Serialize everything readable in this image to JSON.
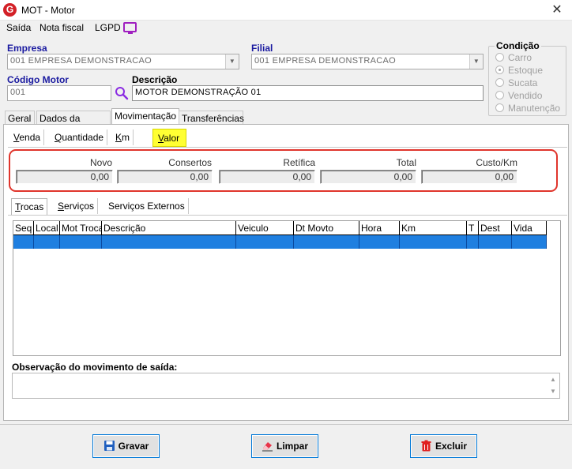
{
  "window": {
    "title": "MOT - Motor",
    "app_icon": "G",
    "close": "✕"
  },
  "menu": [
    "Saída",
    "Nota fiscal",
    "LGPD"
  ],
  "form": {
    "empresa_label": "Empresa",
    "empresa_value": "001 EMPRESA DEMONSTRACAO",
    "filial_label": "Filial",
    "filial_value": "001 EMPRESA DEMONSTRACAO",
    "codigo_label": "Código Motor",
    "codigo_value": "001",
    "descricao_label": "Descrição",
    "descricao_value": "MOTOR DEMONSTRAÇÃO 01"
  },
  "condicao": {
    "title": "Condição",
    "options": [
      "Carro",
      "Estoque",
      "Sucata",
      "Vendido",
      "Manutenção"
    ],
    "selected": "Estoque"
  },
  "tabs": [
    "Geral",
    "Dados da compra",
    "Movimentação",
    "Transferências"
  ],
  "active_tab": "Movimentação",
  "subtabs": [
    "Venda",
    "Quantidade",
    "Km",
    "Valor"
  ],
  "active_subtab": "Valor",
  "valores": {
    "headers": [
      "Novo",
      "Consertos",
      "Retífica",
      "Total",
      "Custo/Km"
    ],
    "values": [
      "0,00",
      "0,00",
      "0,00",
      "0,00",
      "0,00"
    ]
  },
  "inner_tabs": [
    "Trocas",
    "Serviços",
    "Serviços Externos"
  ],
  "grid": {
    "columns": [
      "Seq",
      "Local",
      "Mot Troca",
      "Descrição",
      "Veiculo",
      "Dt Movto",
      "Hora",
      "Km",
      "T",
      "Dest",
      "Vida"
    ]
  },
  "observacao_label": "Observação do movimento de saída:",
  "buttons": {
    "gravar": "Gravar",
    "limpar": "Limpar",
    "excluir": "Excluir"
  },
  "colors": {
    "accent": "#0078d7",
    "selection": "#1f7fe0",
    "highlight": "#ffff33",
    "alert_box": "#e0352c",
    "label_blue": "#1a1aa0"
  }
}
